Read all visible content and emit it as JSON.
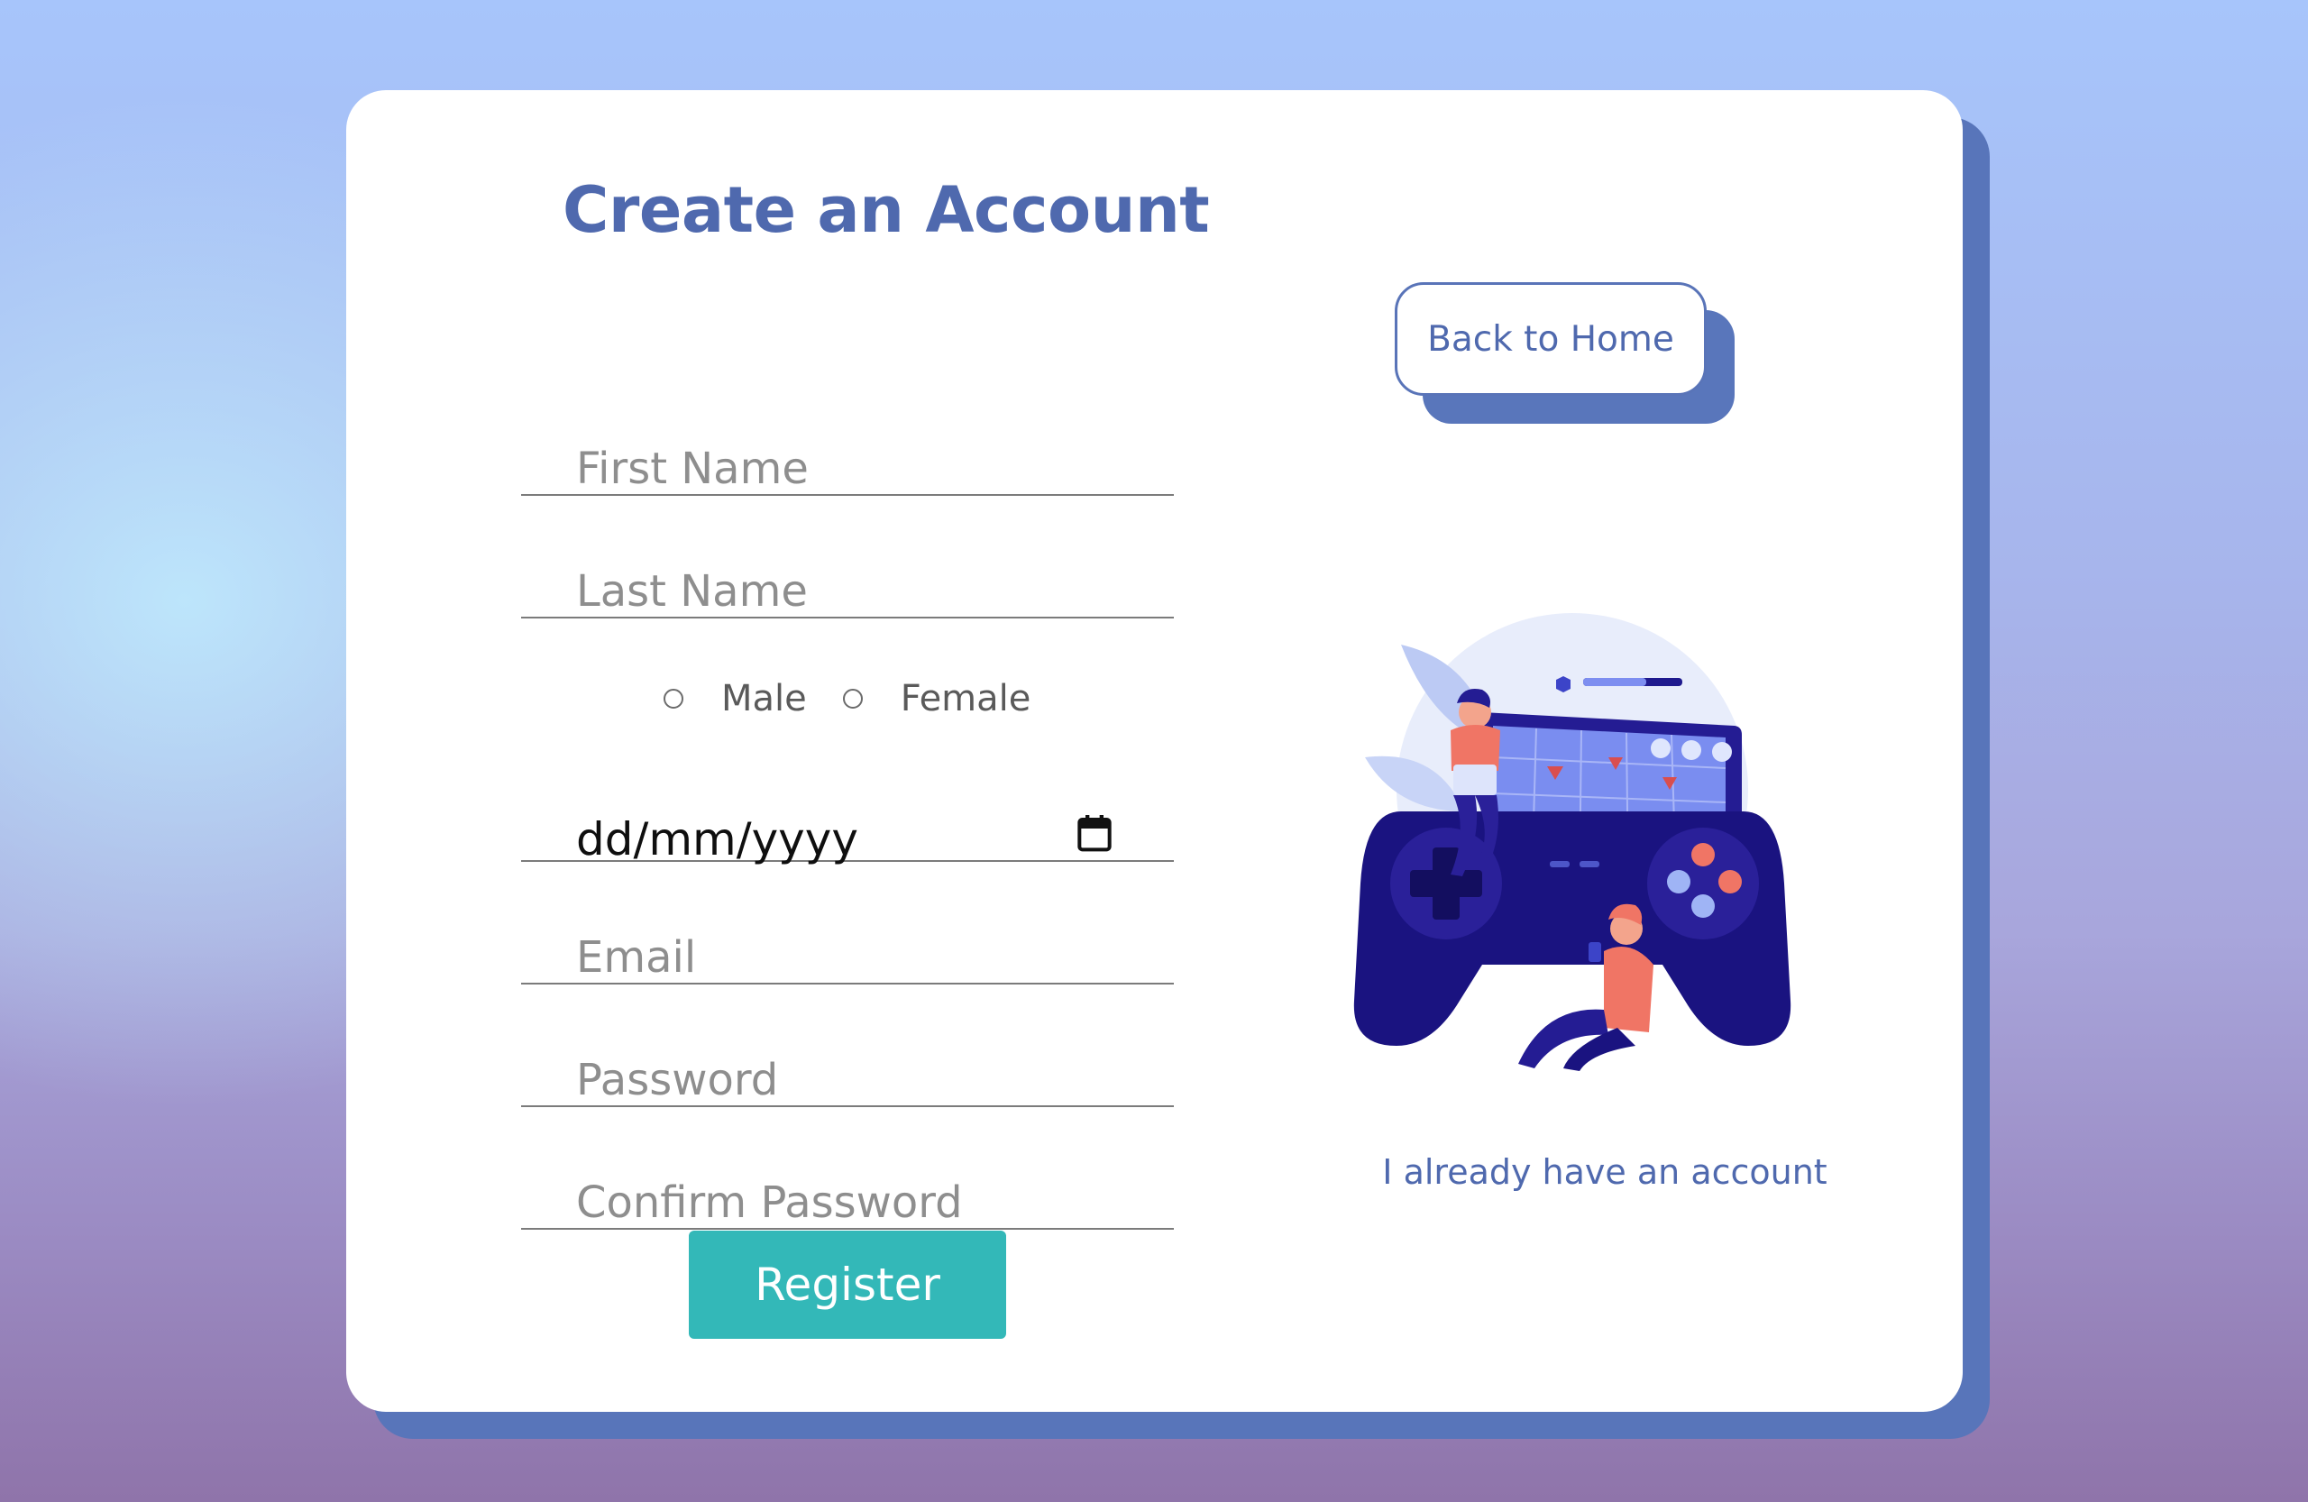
{
  "form": {
    "title": "Create an Account",
    "first_name_placeholder": "First Name",
    "last_name_placeholder": "Last Name",
    "gender_options": [
      "Male",
      "Female"
    ],
    "date_placeholder": "dd/mm/yyyy",
    "email_placeholder": "Email",
    "password_placeholder": "Password",
    "confirm_password_placeholder": "Confirm Password",
    "register_label": "Register"
  },
  "side": {
    "back_home_label": "Back to Home",
    "login_link_label": "I already have an account"
  },
  "colors": {
    "accent": "#4f69ae",
    "button": "#33b8b8",
    "card_shadow": "#5875ba"
  },
  "icons": {
    "date_picker": "calendar-icon",
    "illustration": "gaming-controller-illustration"
  }
}
